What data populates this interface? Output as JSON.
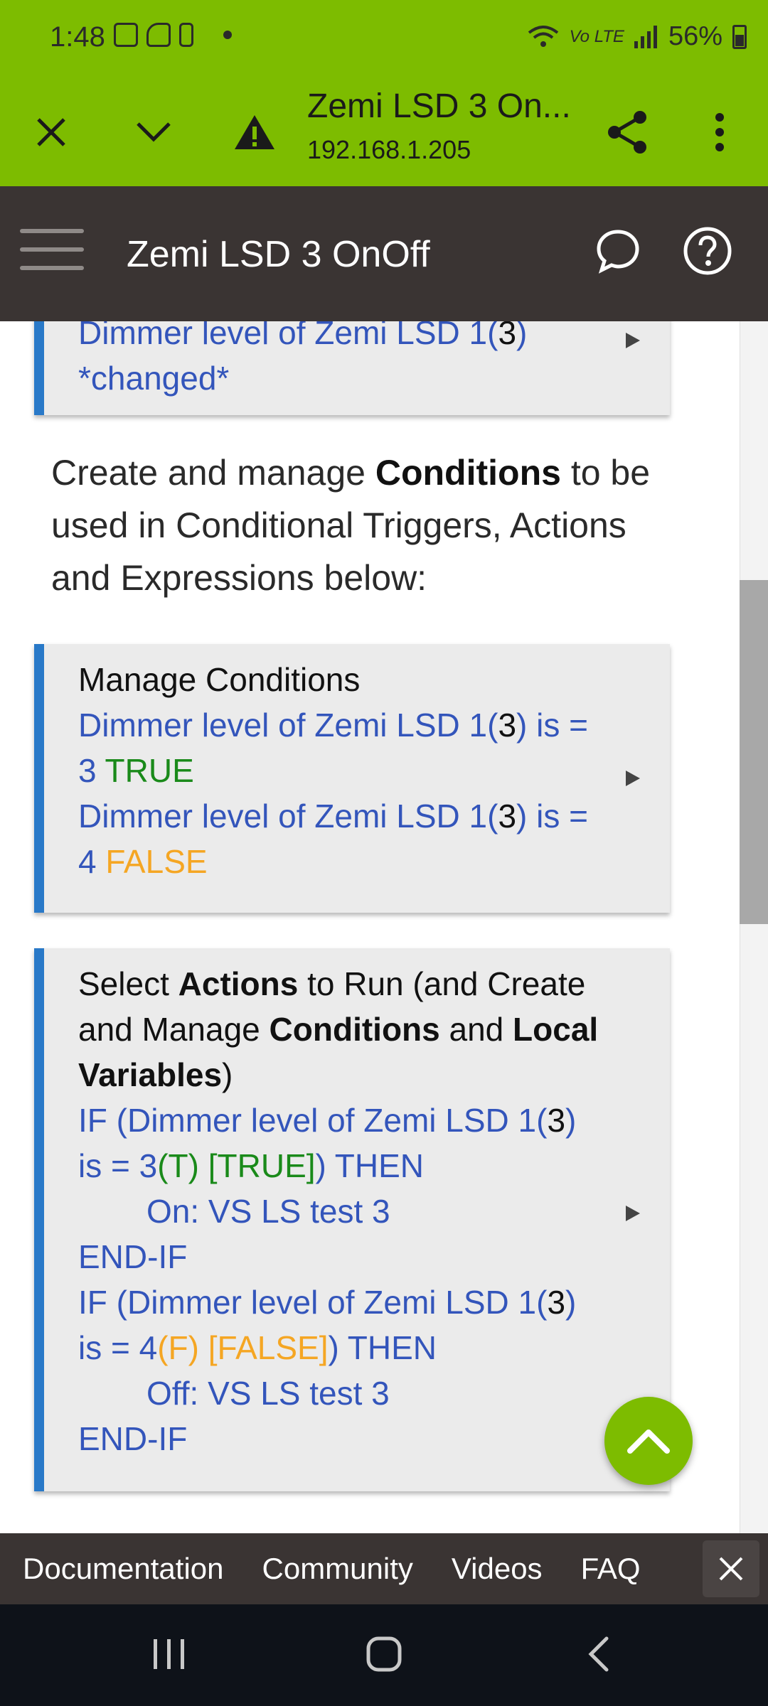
{
  "status_bar": {
    "time": "1:48",
    "battery": "56%"
  },
  "browser": {
    "title": "Zemi LSD 3 On...",
    "url": "192.168.1.205"
  },
  "app": {
    "title": "Zemi LSD 3 OnOff"
  },
  "top_card": {
    "line1": "Dimmer level of Zemi LSD 1(",
    "num": "3",
    "line1_end": ")",
    "line2": "*changed*"
  },
  "intro": {
    "pre": "Create and manage ",
    "bold": "Conditions",
    "post": " to be used in Conditional Triggers, Actions and Expressions below:"
  },
  "conditions_card": {
    "heading": "Manage Conditions",
    "c1_pre": "Dimmer level of Zemi LSD 1(",
    "c1_num": "3",
    "c1_post": ") is = 3 ",
    "c1_state": "TRUE",
    "c2_pre": "Dimmer level of Zemi LSD 1(",
    "c2_num": "3",
    "c2_post": ") is = 4 ",
    "c2_state": "FALSE"
  },
  "actions_card": {
    "h_pre": "Select ",
    "h_b1": "Actions",
    "h_mid": " to Run (and Create and Manage ",
    "h_b2": "Conditions",
    "h_and": " and ",
    "h_b3": "Local Variables",
    "h_end": ")",
    "if1_pre": "IF (Dimmer level of Zemi LSD 1(",
    "if1_num": "3",
    "if1_mid": ") is = 3",
    "if1_state": "(T) [TRUE]",
    "if1_end": ") THEN",
    "act1": "On: VS LS test 3",
    "endif1": "END-IF",
    "if2_pre": "IF (Dimmer level of Zemi LSD 1(",
    "if2_num": "3",
    "if2_mid": ") is = 4",
    "if2_state": "(F) [FALSE]",
    "if2_end": ") THEN",
    "act2": "Off: VS LS test 3",
    "endif2": "END-IF"
  },
  "footer": {
    "links": [
      "Documentation",
      "Community",
      "Videos",
      "FAQ"
    ]
  },
  "colors": {
    "accent": "#7dbc00",
    "header": "#3a3433",
    "card_border": "#2979c8",
    "true": "#1a8a1a",
    "false": "#f5a623",
    "link": "#3355bb"
  }
}
